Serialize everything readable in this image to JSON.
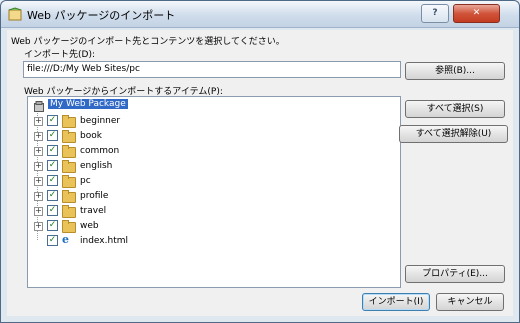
{
  "window": {
    "title": "Web パッケージのインポート"
  },
  "titlebar": {
    "help_label": "?",
    "close_label": "✕"
  },
  "dialog": {
    "instruction": "Web パッケージのインポート先とコンテンツを選択してください。",
    "destination_label": "インポート先(D):",
    "destination_value": "file:///D:/My Web Sites/pc",
    "browse_label": "参照(B)...",
    "items_label": "Web パッケージからインポートするアイテム(P):",
    "select_all_label": "すべて選択(S)",
    "deselect_all_label": "すべて選択解除(U)",
    "properties_label": "プロパティ(E)...",
    "import_label": "インポート(I)",
    "cancel_label": "キャンセル"
  },
  "tree": {
    "root": "My Web Package",
    "folders": [
      "beginner",
      "book",
      "common",
      "english",
      "pc",
      "profile",
      "travel",
      "web"
    ],
    "file": "index.html"
  }
}
